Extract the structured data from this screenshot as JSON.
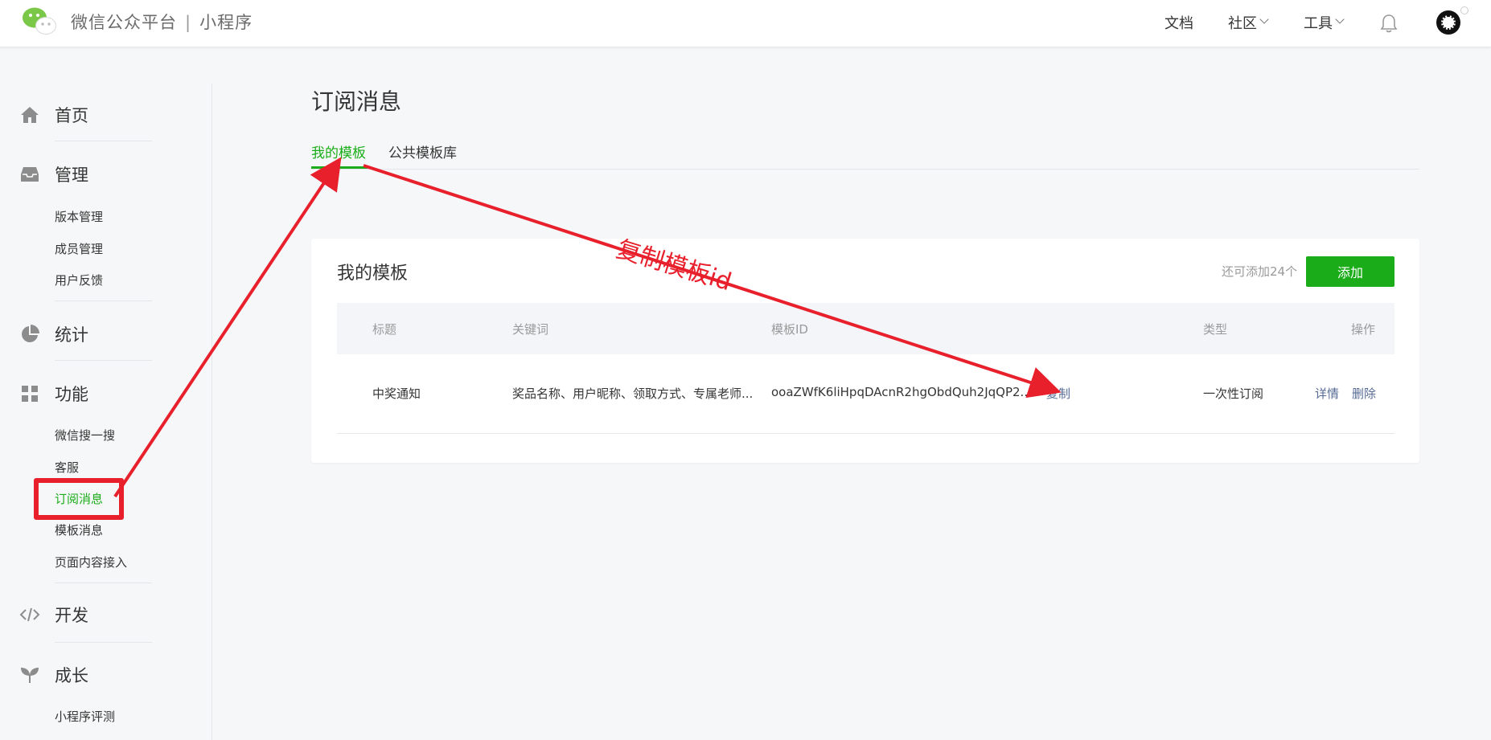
{
  "header": {
    "brand_name": "微信公众平台",
    "separator": "|",
    "product_name": "小程序",
    "nav": {
      "docs": "文档",
      "community": "社区",
      "tools": "工具"
    }
  },
  "sidebar": {
    "groups": [
      {
        "label": "首页",
        "icon": "home-icon",
        "items": []
      },
      {
        "label": "管理",
        "icon": "inbox-icon",
        "items": [
          "版本管理",
          "成员管理",
          "用户反馈"
        ]
      },
      {
        "label": "统计",
        "icon": "pie-chart-icon",
        "items": []
      },
      {
        "label": "功能",
        "icon": "grid-icon",
        "items": [
          "微信搜一搜",
          "客服",
          "订阅消息",
          "模板消息",
          "页面内容接入"
        ]
      },
      {
        "label": "开发",
        "icon": "code-icon",
        "items": []
      },
      {
        "label": "成长",
        "icon": "sprout-icon",
        "items": [
          "小程序评测"
        ]
      }
    ],
    "active_item": "订阅消息"
  },
  "main": {
    "page_title": "订阅消息",
    "tabs": [
      {
        "label": "我的模板",
        "active": true
      },
      {
        "label": "公共模板库",
        "active": false
      }
    ],
    "card": {
      "title": "我的模板",
      "quota_text": "还可添加24个",
      "add_button": "添加",
      "table": {
        "headers": [
          "标题",
          "关键词",
          "模板ID",
          "类型",
          "操作"
        ],
        "rows": [
          {
            "title": "中奖通知",
            "keywords": "奖品名称、用户昵称、领取方式、专属老师...",
            "template_id": "ooaZWfK6liHpqDAcnR2hgObdQuh2JqQP2...",
            "copy_action": "复制",
            "type": "一次性订阅",
            "actions": [
              "详情",
              "删除"
            ]
          }
        ]
      }
    }
  },
  "annotation": {
    "text": "复制模板id",
    "color": "#e8202c"
  },
  "colors": {
    "accent_green": "#1aad19",
    "link_blue": "#576b95",
    "annotation_red": "#e8202c"
  }
}
